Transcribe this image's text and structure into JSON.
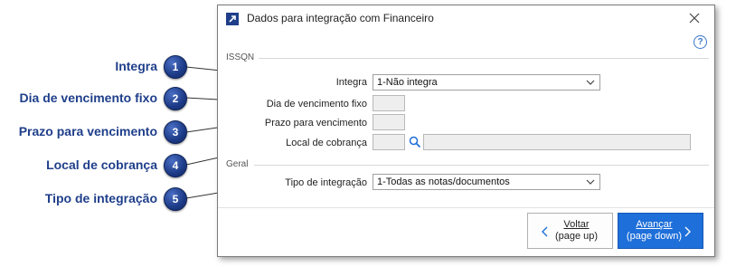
{
  "callouts": [
    {
      "number": "1",
      "label": "Integra"
    },
    {
      "number": "2",
      "label": "Dia de vencimento fixo"
    },
    {
      "number": "3",
      "label": "Prazo para vencimento"
    },
    {
      "number": "4",
      "label": "Local de cobrança"
    },
    {
      "number": "5",
      "label": "Tipo de integração"
    }
  ],
  "dialog": {
    "title": "Dados para integração com Financeiro",
    "help_symbol": "?",
    "sections": {
      "issqn": "ISSQN",
      "geral": "Geral"
    },
    "fields": {
      "integra": {
        "label": "Integra",
        "value": "1-Não integra"
      },
      "dia_vencimento": {
        "label": "Dia de vencimento fixo",
        "value": ""
      },
      "prazo_vencimento": {
        "label": "Prazo para vencimento",
        "value": ""
      },
      "local_cobranca": {
        "label": "Local de cobrança",
        "code": "",
        "description": ""
      },
      "tipo_integracao": {
        "label": "Tipo de integração",
        "value": "1-Todas as notas/documentos"
      }
    },
    "buttons": {
      "back": {
        "label": "Voltar",
        "hint": "(page up)"
      },
      "next": {
        "label": "Avançar",
        "hint": "(page down)"
      }
    }
  },
  "colors": {
    "callout_text": "#1f3f8a",
    "badge": "#1c3a86",
    "primary_button": "#1e6fd9",
    "help_icon": "#3a78c8"
  },
  "icons": {
    "title": "external-link-icon",
    "close": "close-icon",
    "help": "help-icon",
    "search": "search-icon",
    "dropdown": "chevron-down-icon",
    "back": "chevron-left-icon",
    "next": "chevron-right-icon"
  }
}
